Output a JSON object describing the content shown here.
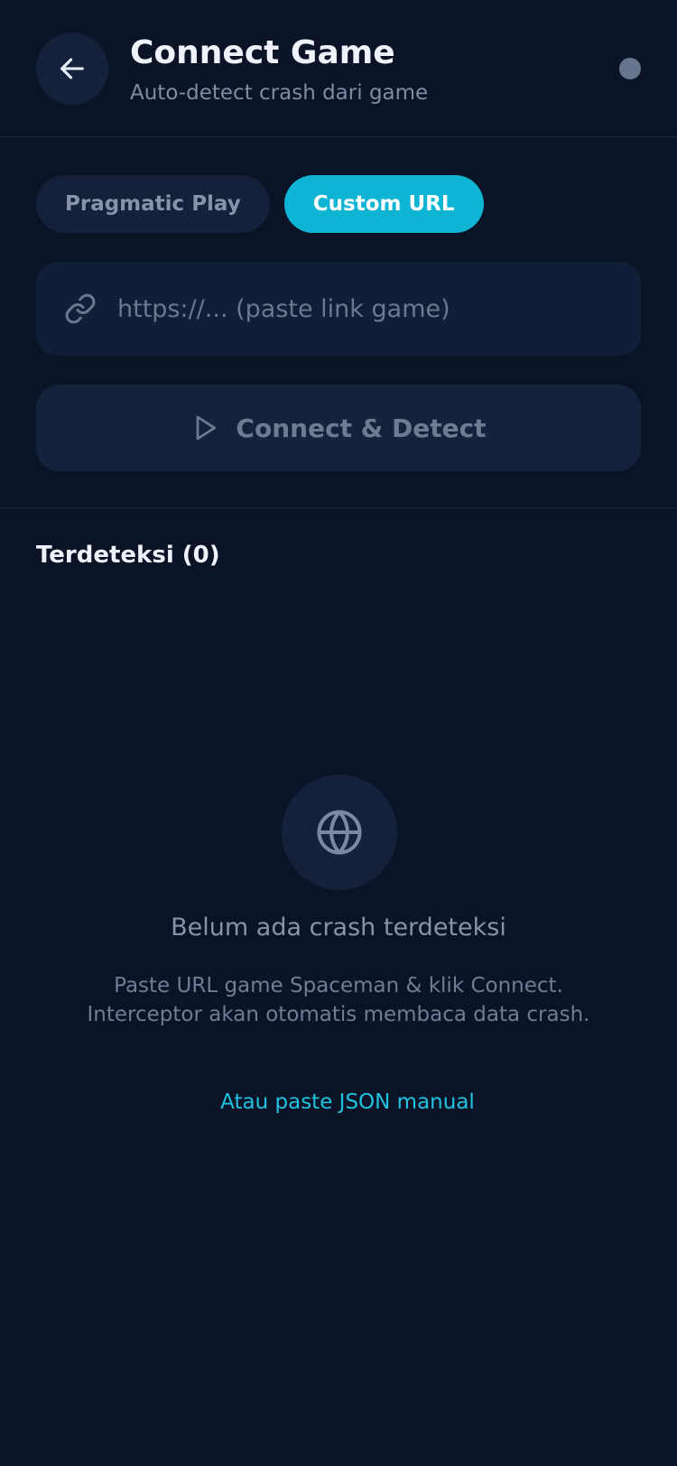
{
  "header": {
    "title": "Connect Game",
    "subtitle": "Auto-detect crash dari game",
    "back_icon": "arrow-left-icon",
    "status_color": "#66768f"
  },
  "tabs": [
    {
      "label": "Pragmatic Play",
      "active": false
    },
    {
      "label": "Custom URL",
      "active": true
    }
  ],
  "url_input": {
    "placeholder": "https://... (paste link game)",
    "value": "",
    "icon": "link-icon"
  },
  "connect_button": {
    "label": "Connect & Detect",
    "icon": "play-icon"
  },
  "detected": {
    "title": "Terdeteksi (0)"
  },
  "empty_state": {
    "icon": "globe-icon",
    "title": "Belum ada crash terdeteksi",
    "description_line1": "Paste URL game Spaceman & klik Connect.",
    "description_line2": "Interceptor akan otomatis membaca data crash.",
    "manual_link": "Atau paste JSON manual"
  },
  "colors": {
    "background": "#0b1427",
    "accent": "#0eb4d4",
    "link": "#1fc2e0"
  }
}
